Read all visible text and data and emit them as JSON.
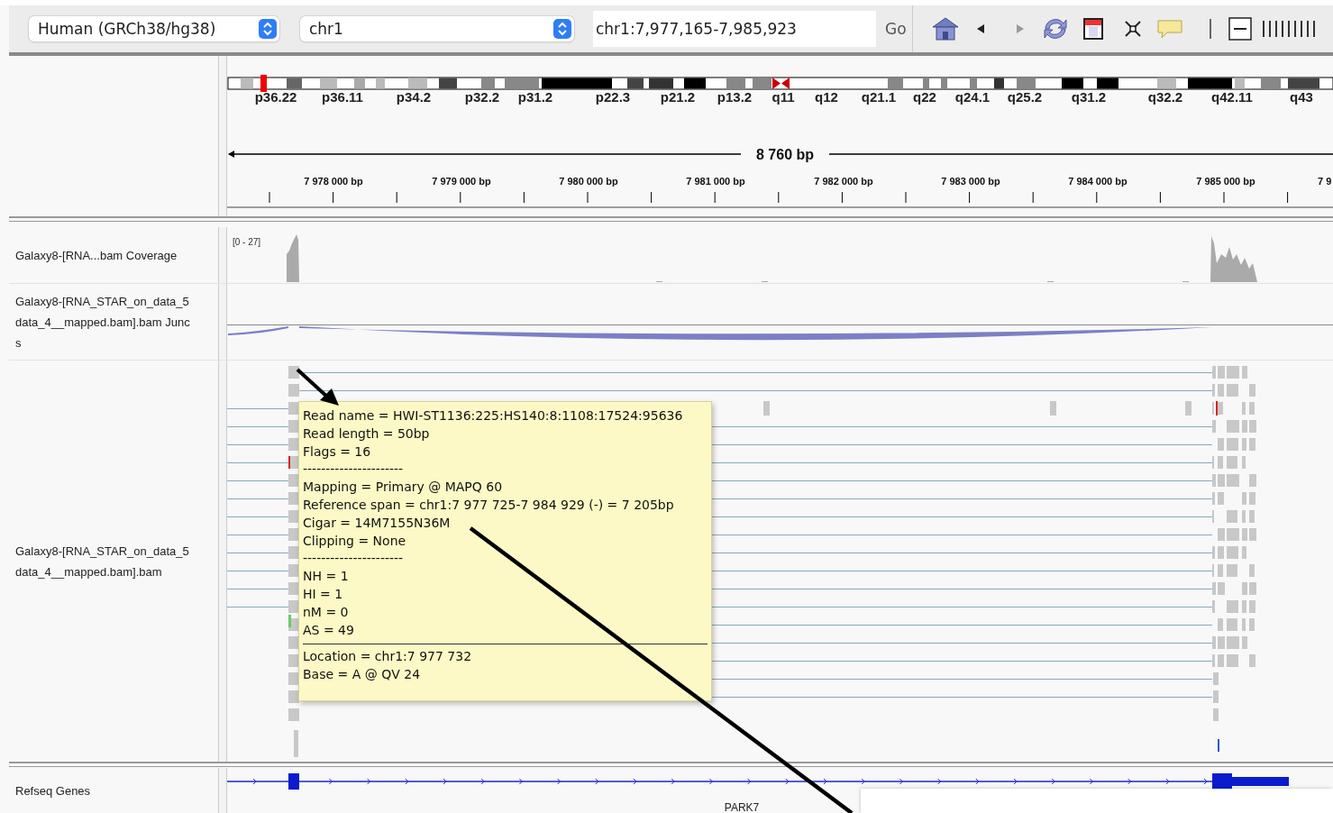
{
  "toolbar": {
    "genome": "Human (GRCh38/hg38)",
    "chromosome": "chr1",
    "locus": "chr1:7,977,165-7,985,923",
    "go_button": "Go"
  },
  "ideogram": {
    "bands": [
      "p36.22",
      "p36.11",
      "p34.2",
      "p32.2",
      "p31.2",
      "p22.3",
      "p21.2",
      "p13.2",
      "q11",
      "q12",
      "q21.1",
      "q22",
      "q24.1",
      "q25.2",
      "q31.2",
      "q32.2",
      "q42.11",
      "q43"
    ]
  },
  "ruler": {
    "span": "8 760 bp",
    "ticks": [
      "7 978 000 bp",
      "7 979 000 bp",
      "7 980 000 bp",
      "7 981 000 bp",
      "7 982 000 bp",
      "7 983 000 bp",
      "7 984 000 bp",
      "7 985 000 bp",
      "7 9"
    ]
  },
  "tracks": [
    {
      "kind": "coverage",
      "name_lines": [
        "Galaxy8-[RNA...bam Coverage"
      ],
      "range": "[0 - 27]"
    },
    {
      "kind": "junctions",
      "name_lines": [
        "Galaxy8-[RNA_STAR_on_data_5",
        "data_4__mapped.bam].bam Junc",
        "s"
      ]
    },
    {
      "kind": "alignments",
      "name_lines": [
        "Galaxy8-[RNA_STAR_on_data_5",
        "data_4__mapped.bam].bam"
      ]
    },
    {
      "kind": "genes",
      "name_lines": [
        "Refseq Genes"
      ],
      "gene": "PARK7"
    }
  ],
  "popup": {
    "groups": [
      [
        "Read name = HWI-ST1136:225:HS140:8:1108:17524:95636",
        "Read length = 50bp",
        "Flags = 16",
        "----------------------",
        "Mapping = Primary @ MAPQ 60",
        "Reference span = chr1:7 977 725-7 984 929 (-) = 7 205bp",
        "Cigar = 14M7155N36M",
        "Clipping = None",
        "----------------------",
        "NH = 1",
        "HI = 1",
        "nM = 0",
        "AS = 49"
      ],
      [
        "Location = chr1:7 977 732",
        "Base = A @ QV 24"
      ]
    ]
  }
}
